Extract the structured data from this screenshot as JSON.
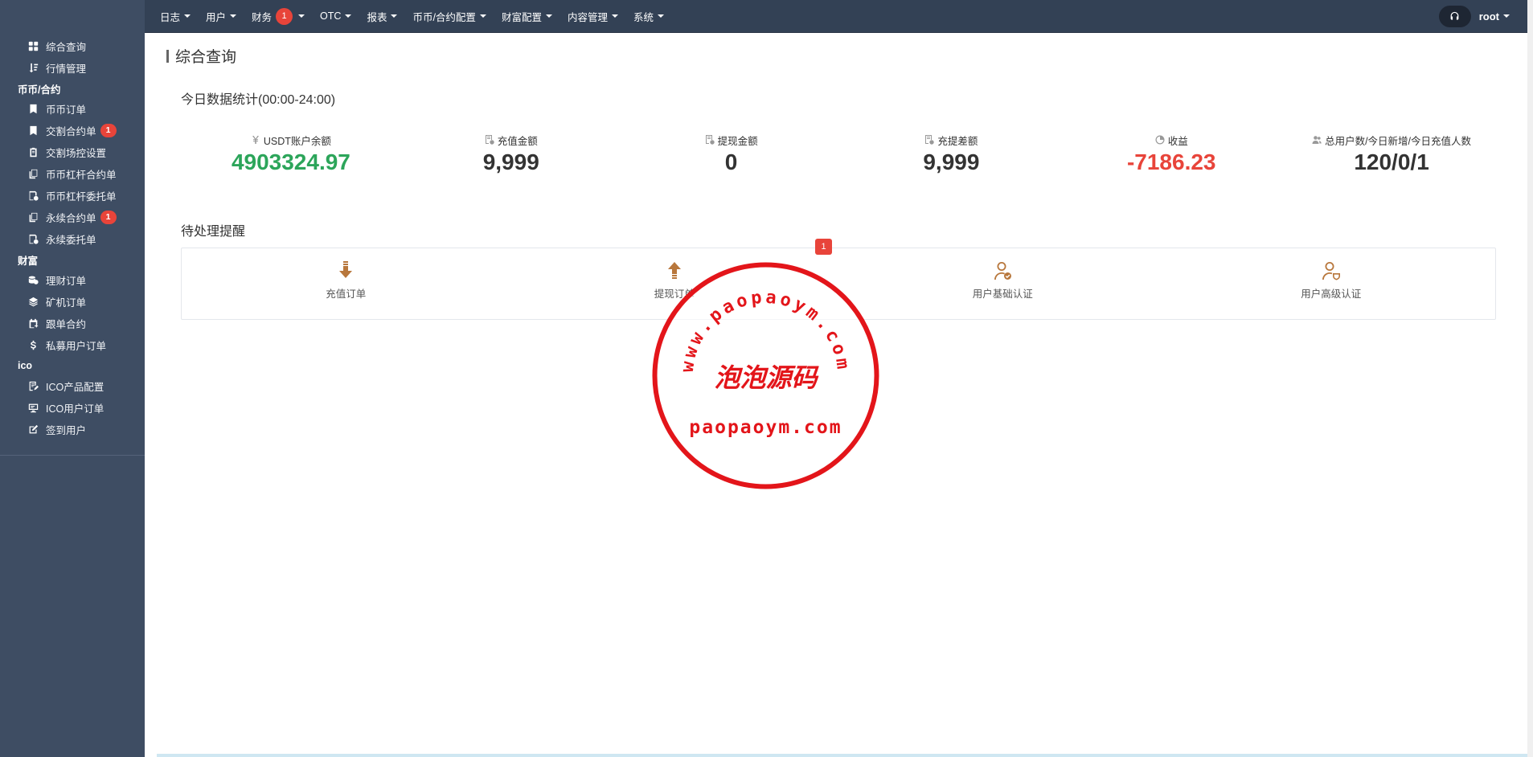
{
  "sidebar": {
    "items": [
      {
        "label": "综合查询",
        "icon": "dashboard-icon"
      },
      {
        "label": "行情管理",
        "icon": "sort-icon"
      }
    ],
    "groups": [
      {
        "title": "币币/合约",
        "items": [
          {
            "label": "币币订单",
            "icon": "bookmark-icon"
          },
          {
            "label": "交割合约单",
            "icon": "bookmark-icon",
            "badge": "1"
          },
          {
            "label": "交割场控设置",
            "icon": "clipboard-icon"
          },
          {
            "label": "币币杠杆合约单",
            "icon": "copy-icon"
          },
          {
            "label": "币币杠杆委托单",
            "icon": "file-clock-icon"
          },
          {
            "label": "永续合约单",
            "icon": "copy-icon",
            "badge": "1"
          },
          {
            "label": "永续委托单",
            "icon": "file-clock-icon"
          }
        ]
      },
      {
        "title": "财富",
        "items": [
          {
            "label": "理财订单",
            "icon": "coins-icon"
          },
          {
            "label": "矿机订单",
            "icon": "layers-icon"
          },
          {
            "label": "跟单合约",
            "icon": "calendar-icon"
          },
          {
            "label": "私募用户订单",
            "icon": "dollar-icon"
          }
        ]
      },
      {
        "title": "ico",
        "items": [
          {
            "label": "ICO产品配置",
            "icon": "edit-doc-icon"
          },
          {
            "label": "ICO用户订单",
            "icon": "monitor-icon"
          },
          {
            "label": "签到用户",
            "icon": "edit-icon"
          }
        ]
      }
    ]
  },
  "topnav": {
    "items": [
      {
        "label": "日志"
      },
      {
        "label": "用户"
      },
      {
        "label": "财务",
        "badge": "1"
      },
      {
        "label": "OTC"
      },
      {
        "label": "报表"
      },
      {
        "label": "币币/合约配置"
      },
      {
        "label": "财富配置"
      },
      {
        "label": "内容管理"
      },
      {
        "label": "系统"
      }
    ],
    "user": "root"
  },
  "page": {
    "title": "综合查询",
    "stats_title": "今日数据统计(00:00-24:00)",
    "pending_title": "待处理提醒"
  },
  "stats": [
    {
      "label": "USDT账户余额",
      "value": "4903324.97",
      "color": "#2ca55a",
      "icon": "yen-icon"
    },
    {
      "label": "充值金额",
      "value": "9,999",
      "color": "#333333",
      "icon": "receipt-icon"
    },
    {
      "label": "提现金额",
      "value": "0",
      "color": "#333333",
      "icon": "receipt-icon"
    },
    {
      "label": "充提差额",
      "value": "9,999",
      "color": "#333333",
      "icon": "receipt-icon"
    },
    {
      "label": "收益",
      "value": "-7186.23",
      "color": "#e8443a",
      "icon": "pie-icon"
    },
    {
      "label": "总用户数/今日新增/今日充值人数",
      "value": "120/0/1",
      "color": "#333333",
      "icon": "users-icon"
    }
  ],
  "pending": [
    {
      "label": "充值订单",
      "icon": "arrow-down-icon"
    },
    {
      "label": "提现订单",
      "icon": "arrow-up-icon",
      "badge": "1"
    },
    {
      "label": "用户基础认证",
      "icon": "user-check-icon"
    },
    {
      "label": "用户高级认证",
      "icon": "user-shield-icon"
    }
  ],
  "watermark": {
    "top_text": "www.paopaoym.com",
    "center_text": "泡泡源码",
    "bottom_text": "paopaoym.com"
  }
}
